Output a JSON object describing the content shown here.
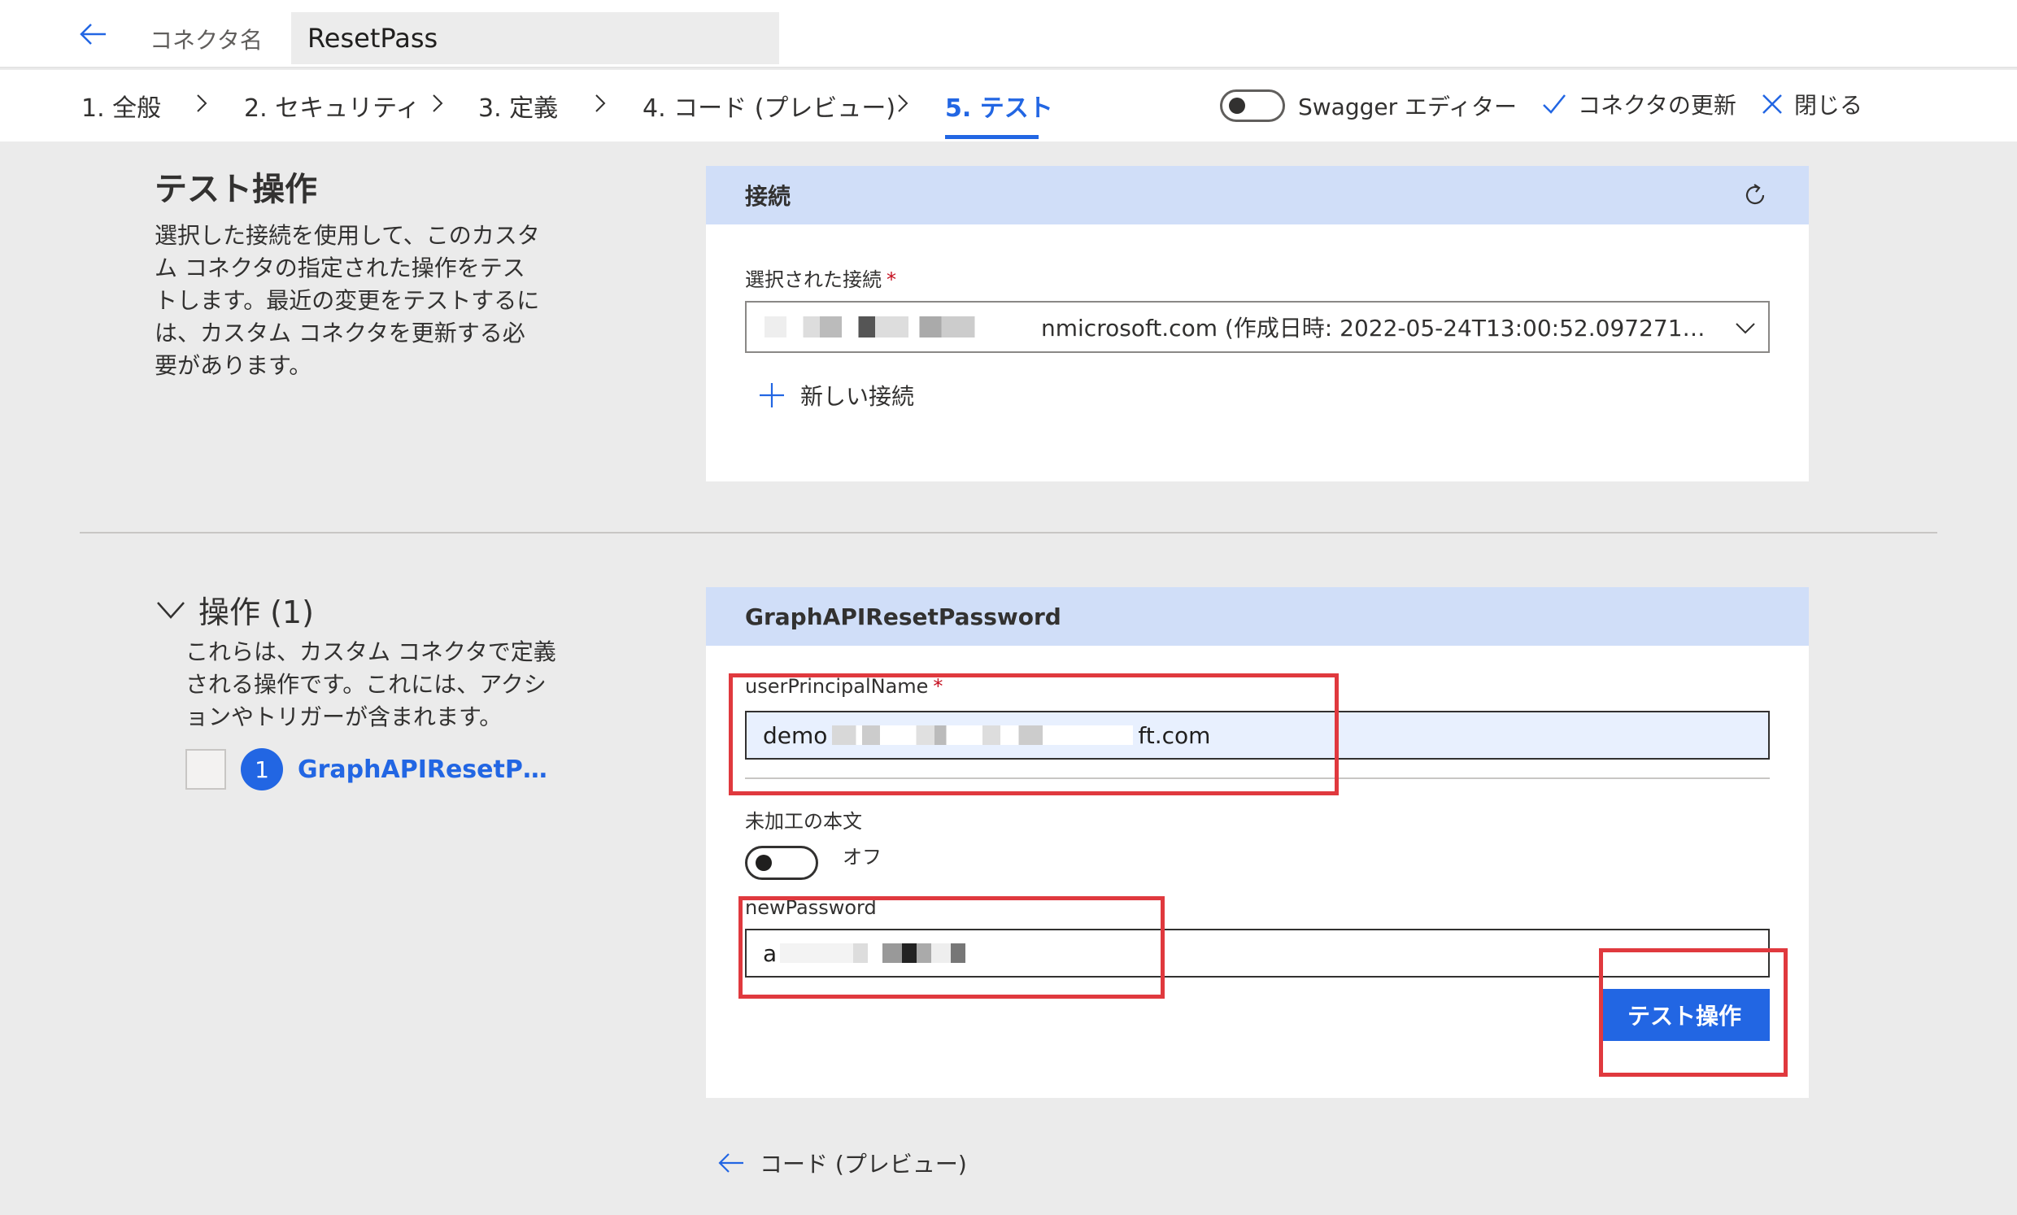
{
  "header": {
    "connector_label": "コネクタ名",
    "connector_name": "ResetPass"
  },
  "steps": [
    {
      "label": "1. 全般"
    },
    {
      "label": "2. セキュリティ"
    },
    {
      "label": "3. 定義"
    },
    {
      "label": "4. コード (プレビュー)"
    },
    {
      "label": "5. テスト"
    }
  ],
  "toolbar": {
    "swagger_label": "Swagger エディター",
    "update_label": "コネクタの更新",
    "close_label": "閉じる"
  },
  "test_section": {
    "title": "テスト操作",
    "description": "選択した接続を使用して、このカスタム コネクタの指定された操作をテストします。最近の変更をテストするには、カスタム コネクタを更新する必要があります。"
  },
  "connection_card": {
    "title": "接続",
    "selected_label": "選択された接続",
    "required_mark": "*",
    "selected_value": "nmicrosoft.com (作成日時: 2022-05-24T13:00:52.097271…",
    "new_connection_label": "新しい接続"
  },
  "operations": {
    "header": "操作 (1)",
    "description": "これらは、カスタム コネクタで定義される操作です。これには、アクションやトリガーが含まれます。",
    "items": [
      {
        "number": "1",
        "name": "GraphAPIResetP…"
      }
    ]
  },
  "operation_card": {
    "title": "GraphAPIResetPassword",
    "upn_label": "userPrincipalName",
    "required_mark": "*",
    "upn_value_prefix": "demo",
    "upn_value_suffix": "ft.com",
    "raw_body_label": "未加工の本文",
    "raw_body_state": "オフ",
    "password_label": "newPassword",
    "password_value_prefix": "a",
    "test_button_label": "テスト操作"
  },
  "footer": {
    "back_label": "コード (プレビュー)"
  },
  "colors": {
    "accent": "#2266e3",
    "card_header": "#d0def8",
    "highlight": "#e0393e",
    "required": "#c50f1f"
  }
}
